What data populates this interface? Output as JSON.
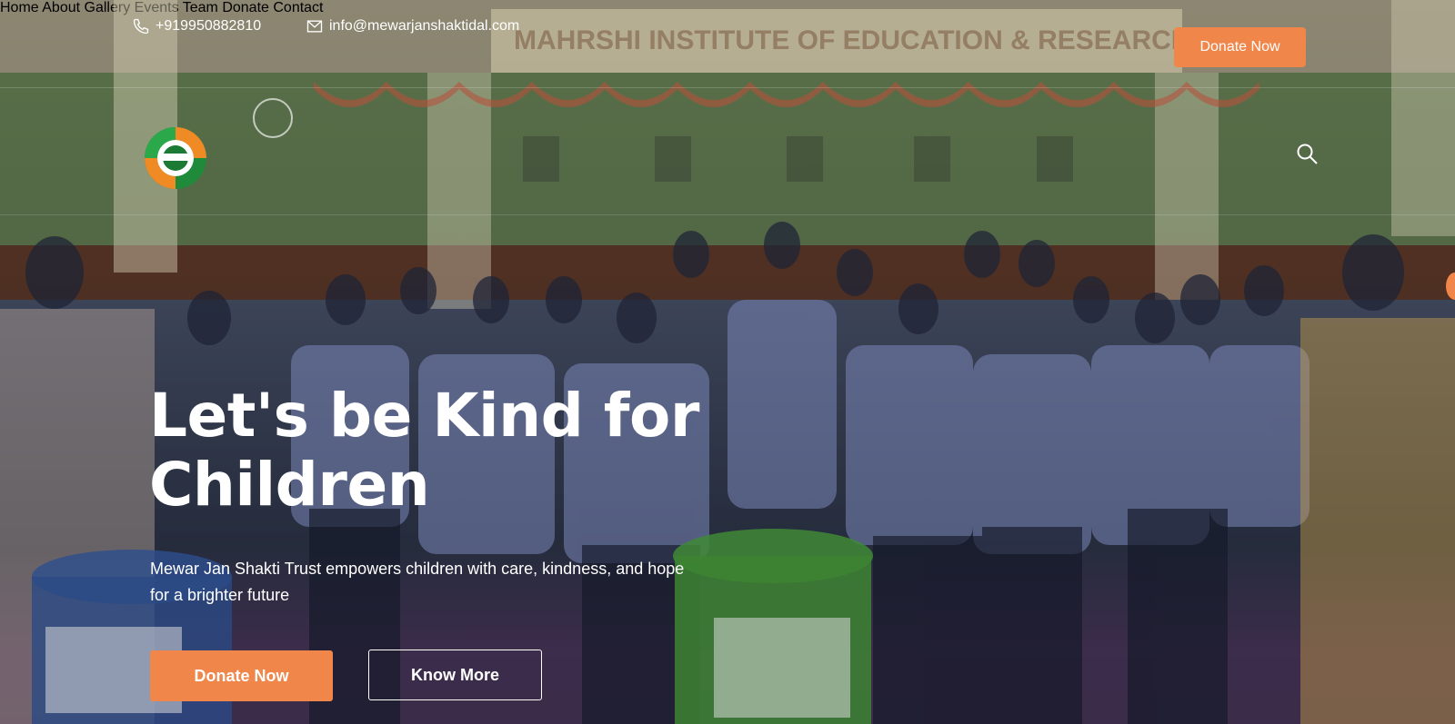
{
  "topbar": {
    "phone": "+919950882810",
    "email": "info@mewarjanshaktidal.com",
    "donate_label": "Donate Now"
  },
  "nav": {
    "items": [
      "Home",
      "About",
      "Gallery",
      "Events",
      "Team",
      "Donate",
      "Contact"
    ]
  },
  "hero": {
    "headline_line1": "Let's be Kind for",
    "headline_line2": "Children",
    "subtitle": "Mewar Jan Shakti Trust empowers children with care, kindness, and hope for a brighter future",
    "primary_button": "Donate Now",
    "secondary_button": "Know More",
    "background_sign": "MAHRSHI INSTITUTE OF EDUCATION & RESEARCH"
  },
  "colors": {
    "accent": "#f0864a",
    "text": "#ffffff"
  },
  "icons": {
    "phone": "phone-icon",
    "email": "envelope-icon",
    "search": "search-icon"
  }
}
